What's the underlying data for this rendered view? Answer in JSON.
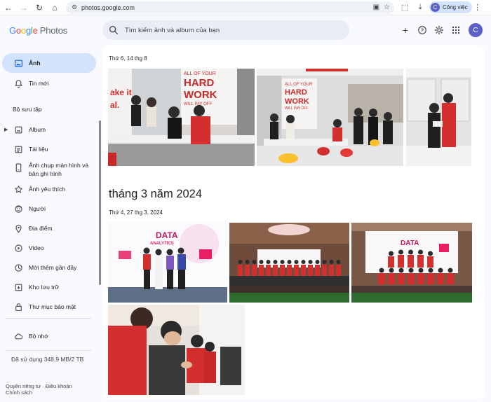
{
  "browser": {
    "url": "photos.google.com",
    "profile_label": "Công việc",
    "profile_initial": "C"
  },
  "header": {
    "logo_google": "Google",
    "logo_product": "Photos",
    "search_placeholder": "Tìm kiếm ảnh và album của bạn",
    "avatar_initial": "C"
  },
  "sidebar": {
    "items_top": [
      {
        "label": "Ảnh",
        "icon": "photo-icon",
        "active": true
      },
      {
        "label": "Tin mới",
        "icon": "bell-icon"
      }
    ],
    "collection_title": "Bộ sưu tập",
    "collection_items": [
      {
        "label": "Album",
        "icon": "album-icon"
      },
      {
        "label": "Tài liệu",
        "icon": "document-icon"
      },
      {
        "label": "Ảnh chụp màn hình và bản ghi hình",
        "line1": "Ảnh chụp màn hình và",
        "line2": "bản ghi hình",
        "icon": "screenshot-icon"
      },
      {
        "label": "Ảnh yêu thích",
        "icon": "star-icon"
      },
      {
        "label": "Người",
        "icon": "face-icon"
      },
      {
        "label": "Địa điểm",
        "icon": "location-icon"
      },
      {
        "label": "Video",
        "icon": "play-icon"
      },
      {
        "label": "Mới thêm gần đây",
        "icon": "clock-icon"
      },
      {
        "label": "Kho lưu trữ",
        "icon": "archive-icon"
      },
      {
        "label": "Thư mục bảo mật",
        "icon": "lock-folder-icon"
      }
    ],
    "storage_label": "Bộ nhớ",
    "storage_used": "Đã sử dụng 348,9 MB/2 TB",
    "footer": {
      "privacy": "Quyền riêng tư",
      "sep": "·",
      "terms": "Điều khoản",
      "policy": "Chính sách"
    }
  },
  "main": {
    "groups": [
      {
        "date": "Thứ 6, 14 thg 8"
      },
      {
        "month": "tháng 3 năm 2024",
        "date": "Thứ 4, 27 thg 3, 2024"
      }
    ],
    "photo_text": {
      "hard_work_1": "ALL OF YOUR",
      "hard_work_2": "HARD",
      "hard_work_3": "WORK",
      "hard_work_4": "WILL PAY OFF",
      "edge_1": "ake it",
      "edge_2": "al.",
      "data": "DATA",
      "analytics": "ANALYTICS"
    }
  },
  "colors": {
    "accent": "#d3e3fd",
    "brand_red": "#e53935",
    "avatar": "#5b5fc7"
  }
}
